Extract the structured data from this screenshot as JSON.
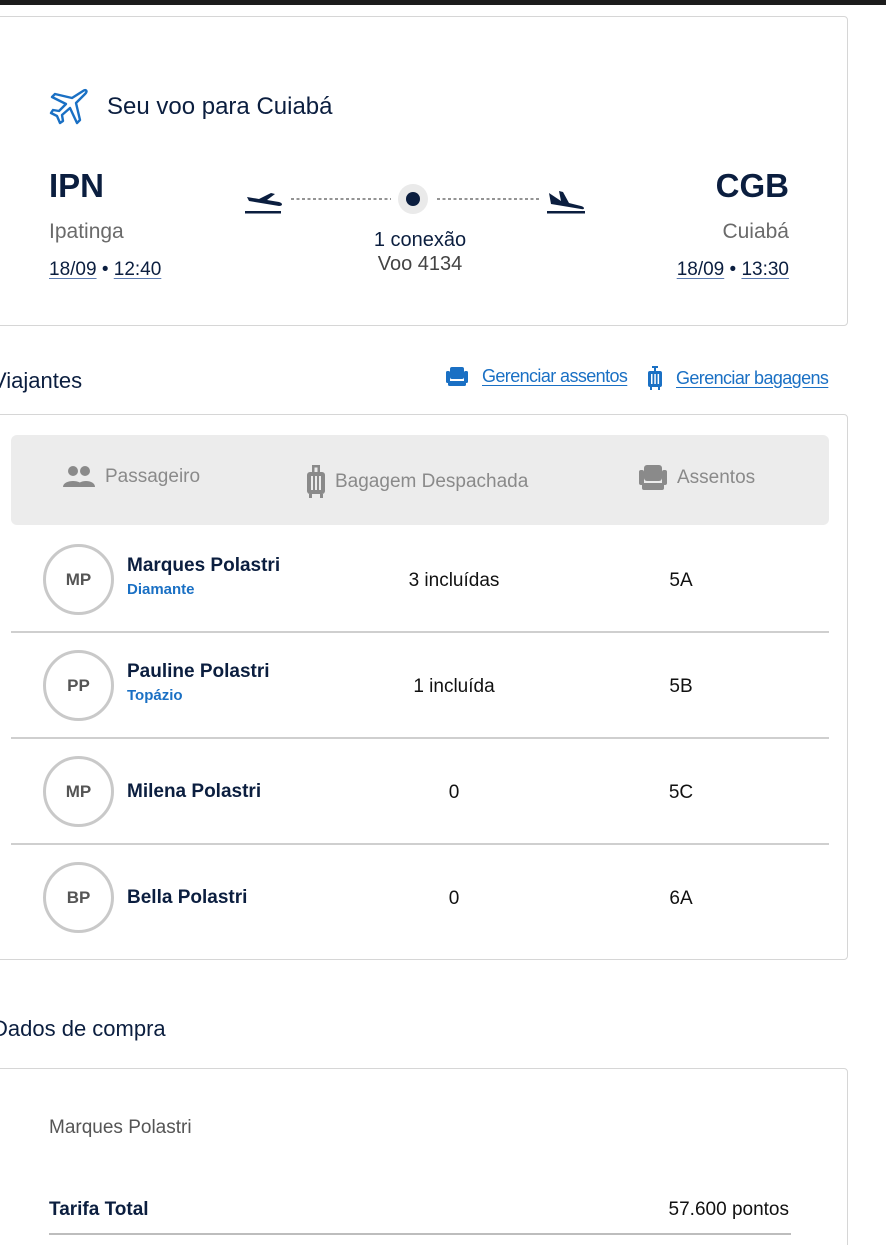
{
  "flight": {
    "title": "Seu voo para Cuiabá",
    "origin": {
      "code": "IPN",
      "city": "Ipatinga",
      "date": "18/09",
      "time": "12:40"
    },
    "destination": {
      "code": "CGB",
      "city": "Cuiabá",
      "date": "18/09",
      "time": "13:30"
    },
    "connections": "1 conexão",
    "flight_number": "Voo 4134",
    "separator": "•"
  },
  "travelers": {
    "title": "Viajantes",
    "manage_seats": "Gerenciar assentos",
    "manage_bags": "Gerenciar bagagens",
    "columns": {
      "passenger": "Passageiro",
      "checked_bag": "Bagagem Despachada",
      "seats": "Assentos"
    },
    "rows": [
      {
        "initials": "MP",
        "name": "Marques Polastri",
        "tier": "Diamante",
        "bags": "3 incluídas",
        "seat": "5A"
      },
      {
        "initials": "PP",
        "name": "Pauline Polastri",
        "tier": "Topázio",
        "bags": "1 incluída",
        "seat": "5B"
      },
      {
        "initials": "MP",
        "name": "Milena Polastri",
        "tier": "",
        "bags": "0",
        "seat": "5C"
      },
      {
        "initials": "BP",
        "name": "Bella Polastri",
        "tier": "",
        "bags": "0",
        "seat": "6A"
      }
    ]
  },
  "purchase": {
    "title": "Dados de compra",
    "buyer": "Marques Polastri",
    "fare_label": "Tarifa Total",
    "fare_value": "57.600 pontos"
  },
  "colors": {
    "navy": "#0b1e3f",
    "link_blue": "#1a70c4",
    "header_bar": "#ececec"
  }
}
